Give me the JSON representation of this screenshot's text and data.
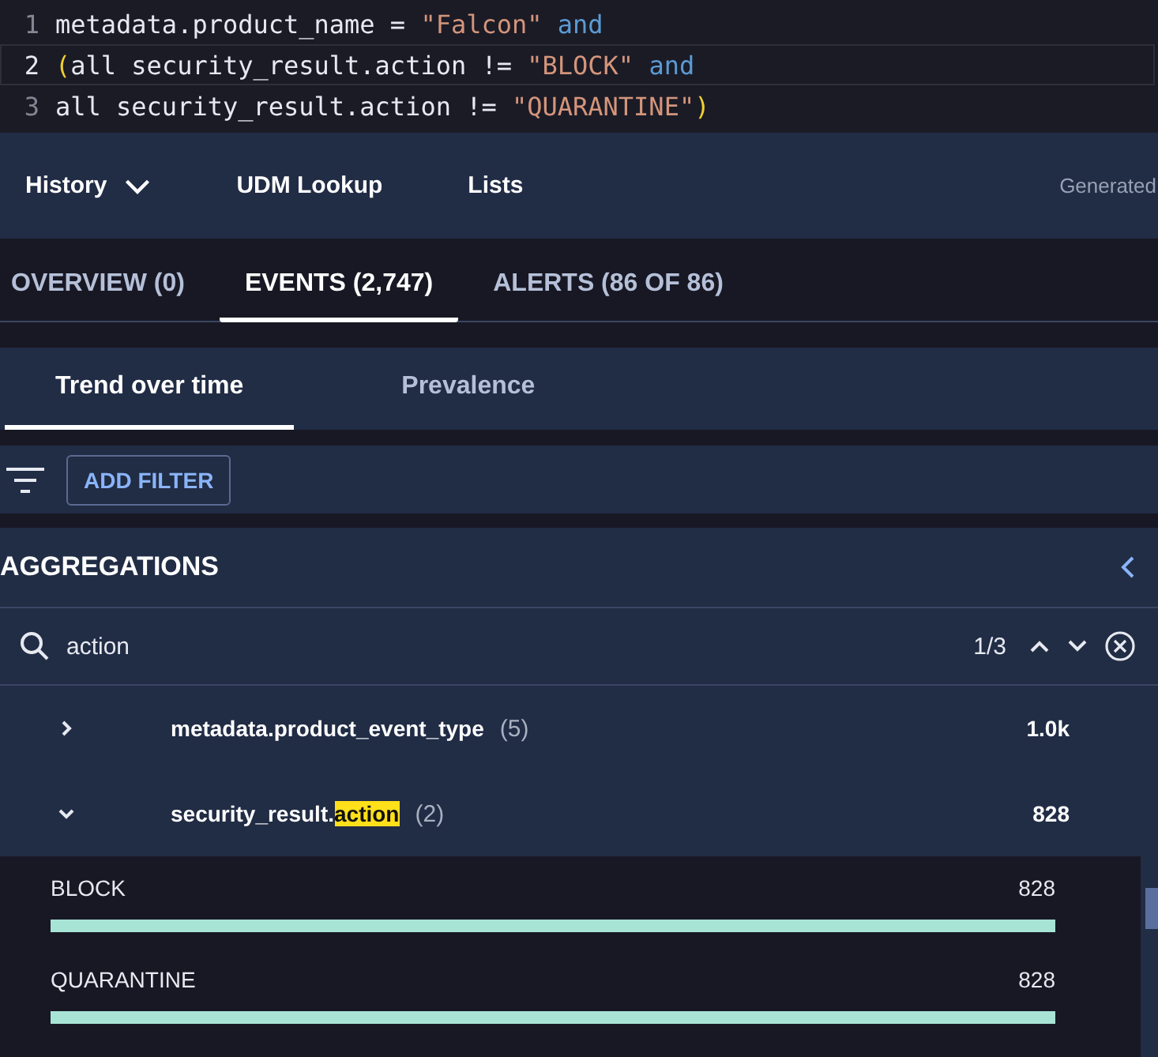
{
  "editor": {
    "lines": [
      {
        "number": "1",
        "current": false,
        "tokens": [
          {
            "kind": "plain",
            "text": "metadata.product_name = "
          },
          {
            "kind": "string",
            "text": "\"Falcon\""
          },
          {
            "kind": "keyword",
            "text": " and"
          }
        ]
      },
      {
        "number": "2",
        "current": true,
        "tokens": [
          {
            "kind": "bracket",
            "text": "("
          },
          {
            "kind": "plain",
            "text": "all security_result.action != "
          },
          {
            "kind": "string",
            "text": "\"BLOCK\""
          },
          {
            "kind": "keyword",
            "text": " and"
          }
        ]
      },
      {
        "number": "3",
        "current": false,
        "tokens": [
          {
            "kind": "plain",
            "text": "all security_result.action != "
          },
          {
            "kind": "string",
            "text": "\"QUARANTINE\""
          },
          {
            "kind": "bracket",
            "text": ")"
          }
        ]
      }
    ]
  },
  "toolbar": {
    "items": [
      {
        "label": "History",
        "dropdown": true
      },
      {
        "label": "UDM Lookup",
        "dropdown": false
      },
      {
        "label": "Lists",
        "dropdown": false
      }
    ],
    "right_text": "Generated"
  },
  "tabs": [
    {
      "label": "OVERVIEW (0)",
      "selected": false
    },
    {
      "label": "EVENTS (2,747)",
      "selected": true
    },
    {
      "label": "ALERTS (86 OF 86)",
      "selected": false
    }
  ],
  "subtabs": [
    {
      "label": "Trend over time",
      "selected": true
    },
    {
      "label": "Prevalence",
      "selected": false
    }
  ],
  "filter_bar": {
    "button": "ADD FILTER"
  },
  "aggregations": {
    "title": "AGGREGATIONS",
    "search": {
      "value": "action",
      "counter": "1/3"
    },
    "fields": [
      {
        "expanded": false,
        "name": [
          {
            "text": "metadata.product_event_type",
            "match": false
          }
        ],
        "count": "(5)",
        "total": "1.0k"
      },
      {
        "expanded": true,
        "name": [
          {
            "text": "security_result.",
            "match": false
          },
          {
            "text": "action",
            "match": true
          }
        ],
        "count": "(2)",
        "total": "828",
        "values": [
          {
            "label": "BLOCK",
            "count": "828",
            "level": 1
          },
          {
            "label": "QUARANTINE",
            "count": "828",
            "level": 1
          }
        ]
      }
    ]
  }
}
